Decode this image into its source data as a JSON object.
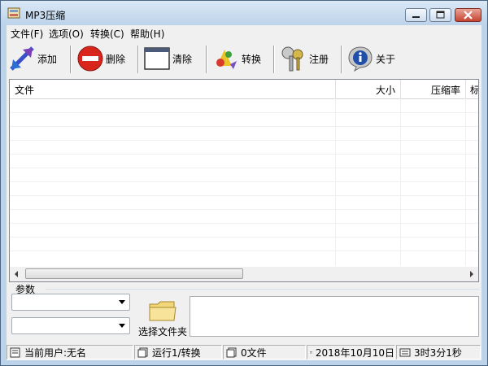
{
  "window": {
    "title": "MP3压缩"
  },
  "menu": [
    {
      "label": "文件(F)"
    },
    {
      "label": "选项(O)"
    },
    {
      "label": "转换(C)"
    },
    {
      "label": "帮助(H)"
    }
  ],
  "toolbar": {
    "add": "添加",
    "delete": "删除",
    "clear": "清除",
    "convert": "转换",
    "register": "注册",
    "about": "关于"
  },
  "list": {
    "columns": [
      "文件",
      "大小",
      "压缩率",
      "标"
    ],
    "rows": []
  },
  "params": {
    "label": "参数",
    "combo1_value": "",
    "combo2_value": "",
    "folder_button": "选择文件夹",
    "output_text": ""
  },
  "status": {
    "user": "当前用户:无名",
    "running": "运行1/转换",
    "files": "0文件",
    "date": "2018年10月10日",
    "time": "3时3分1秒"
  },
  "colors": {
    "titlebar": "#bcd3ea",
    "face": "#f0f0f0",
    "close": "#c54431"
  }
}
